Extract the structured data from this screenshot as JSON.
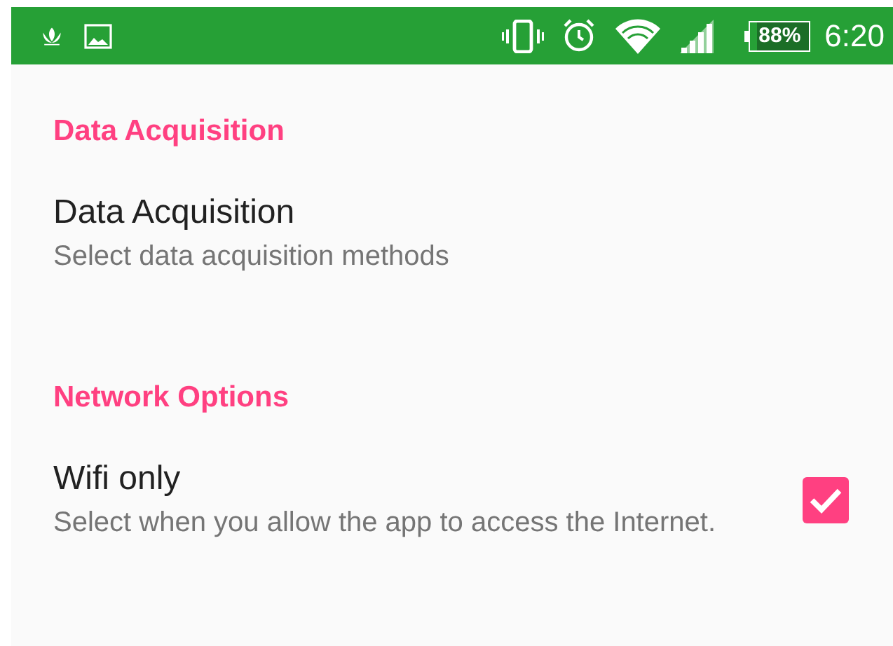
{
  "status_bar": {
    "battery": "88%",
    "time": "6:20"
  },
  "sections": [
    {
      "header": "Data Acquisition",
      "items": [
        {
          "kind": "plain",
          "title": "Data Acquisition",
          "summary": "Select data acquisition methods"
        }
      ]
    },
    {
      "header": "Network Options",
      "items": [
        {
          "kind": "checkbox",
          "title": "Wifi only",
          "summary": "Select when you allow the app to access the Internet.",
          "checked": true
        }
      ]
    }
  ]
}
